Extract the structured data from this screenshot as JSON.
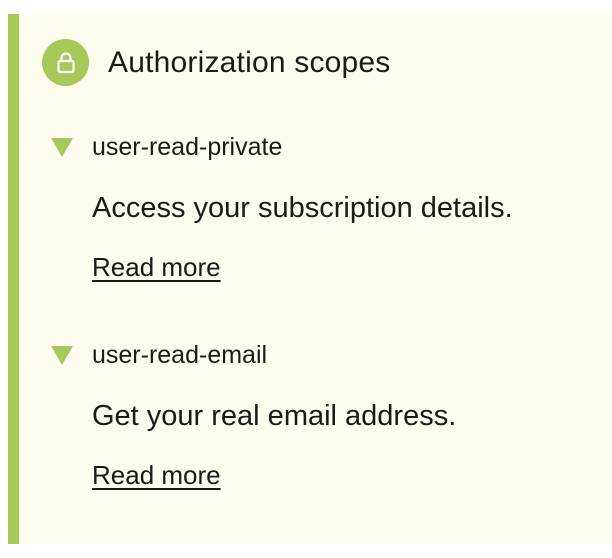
{
  "colors": {
    "accent": "#a6c95a",
    "panel_background": "#fdfcef",
    "text": "#1a1a1a"
  },
  "header": {
    "icon": "lock-icon",
    "title": "Authorization scopes"
  },
  "scopes": [
    {
      "name": "user-read-private",
      "description": "Access your subscription details.",
      "link_label": "Read more",
      "expanded": true
    },
    {
      "name": "user-read-email",
      "description": "Get your real email address.",
      "link_label": "Read more",
      "expanded": true
    }
  ]
}
